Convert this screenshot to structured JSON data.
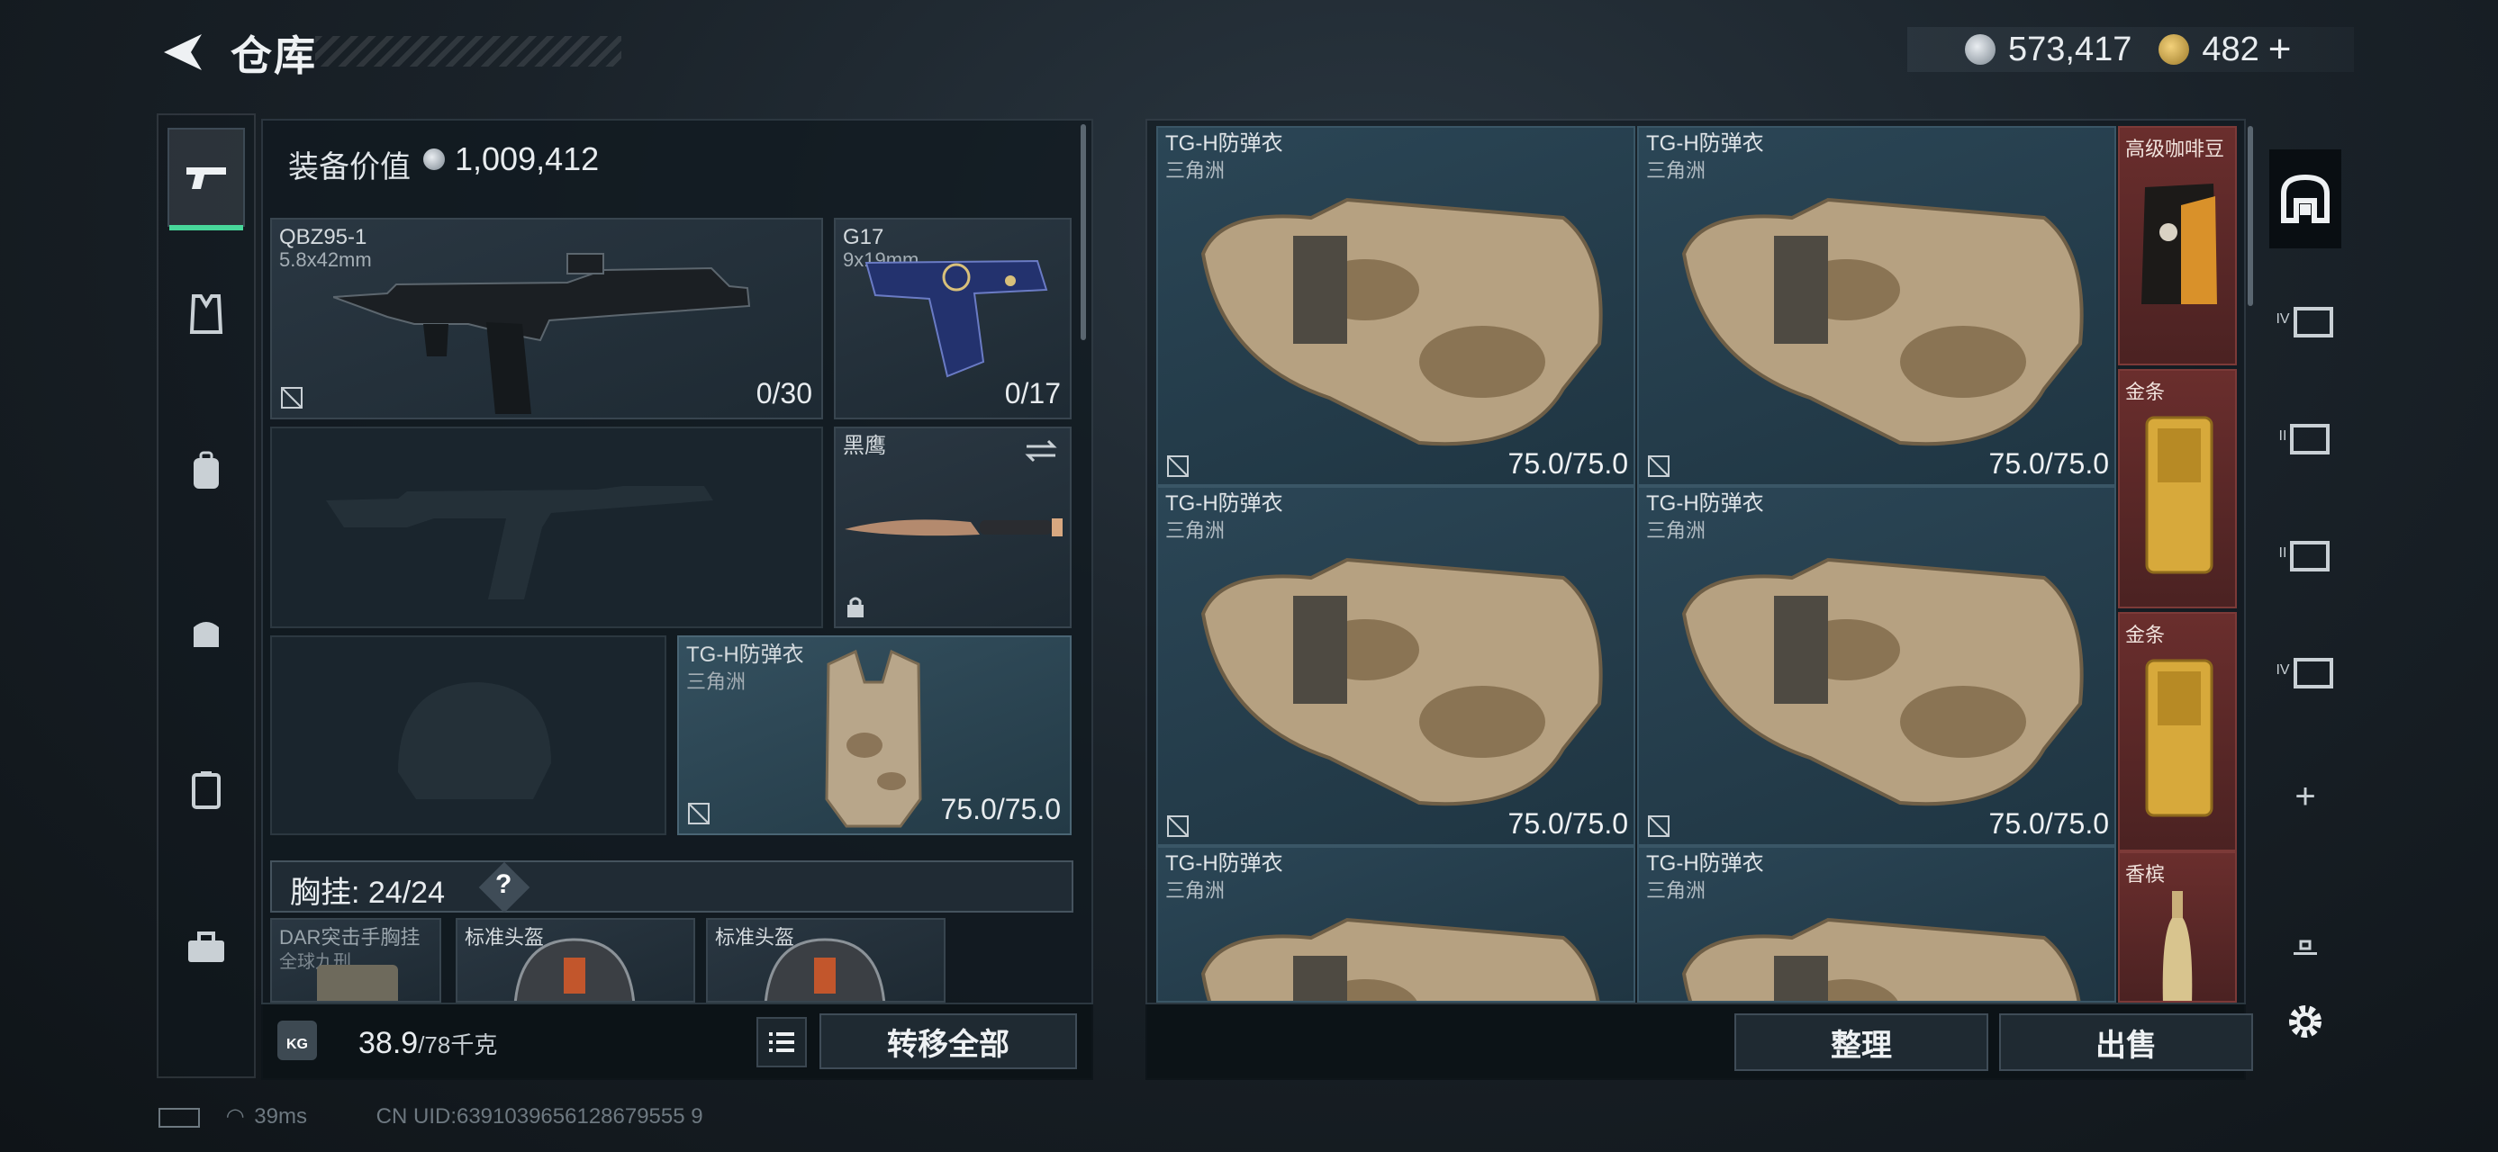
{
  "header": {
    "title": "仓库",
    "currency_silver": "573,417",
    "currency_gold": "482",
    "plus": "+"
  },
  "equipment": {
    "label": "装备价值",
    "value": "1,009,412"
  },
  "slots": {
    "primary": {
      "name": "QBZ95-1",
      "sub": "5.8x42mm",
      "count": "0/30"
    },
    "pistol": {
      "name": "G17",
      "sub": "9x19mm",
      "count": "0/17"
    },
    "knife": {
      "name": "黑鹰"
    },
    "armor": {
      "name": "TG-H防弹衣",
      "sub": "三角洲",
      "count": "75.0/75.0"
    }
  },
  "chest_rig": {
    "label": "胸挂: 24/24",
    "help": "?",
    "items": [
      {
        "name": "DAR突击手胸挂",
        "sub": "全球九刑"
      },
      {
        "name": "标准头盔"
      },
      {
        "name": "标准头盔"
      }
    ]
  },
  "bottom_left": {
    "kg": "KG",
    "weight": "38.9",
    "weight_max": "/78千克",
    "transfer_all": "转移全部"
  },
  "stash": {
    "cells": [
      {
        "name": "TG-H防弹衣",
        "sub": "三角洲",
        "dur": "75.0/75.0"
      },
      {
        "name": "TG-H防弹衣",
        "sub": "三角洲",
        "dur": "75.0/75.0"
      },
      {
        "name": "TG-H防弹衣",
        "sub": "三角洲",
        "dur": "75.0/75.0"
      },
      {
        "name": "TG-H防弹衣",
        "sub": "三角洲",
        "dur": "75.0/75.0"
      },
      {
        "name": "TG-H防弹衣",
        "sub": "三角洲"
      },
      {
        "name": "TG-H防弹衣",
        "sub": "三角洲"
      }
    ],
    "red_items": [
      {
        "name": "高级咖啡豆"
      },
      {
        "name": "金条"
      },
      {
        "name": "金条"
      },
      {
        "name": "香槟"
      }
    ],
    "organize": "整理",
    "sell": "出售"
  },
  "right_sidebar": {
    "labels": [
      "IV",
      "II",
      "II",
      "IV"
    ],
    "add": "+"
  },
  "footer": {
    "ping": "39ms",
    "uid": "CN UID:6391039656128679555 9"
  },
  "colors": {
    "accent_green": "#48d79a",
    "red_item_bg": "#6a2e2d",
    "cell_bg": "#2b4656"
  }
}
